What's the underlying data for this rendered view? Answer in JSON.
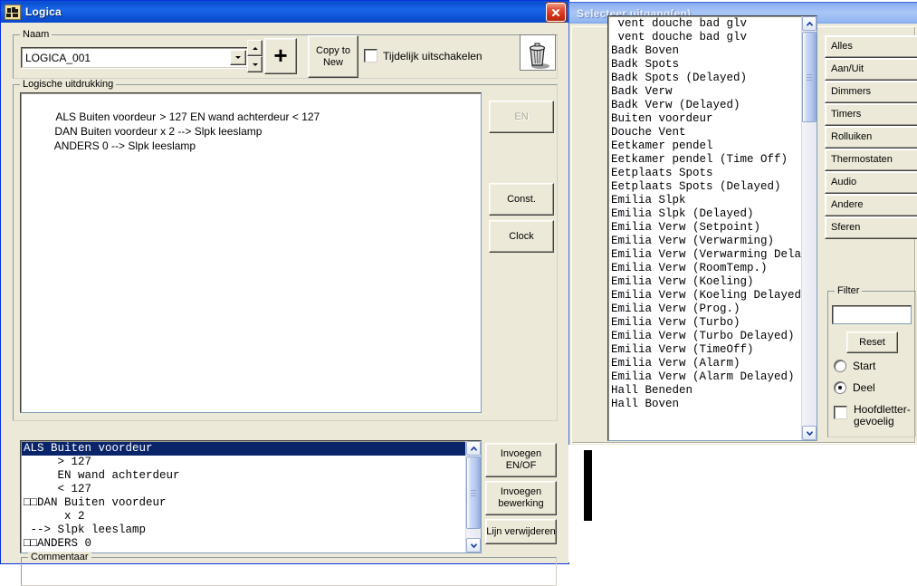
{
  "main_window": {
    "title": "Logica",
    "icon": "logica-app-icon",
    "close_label": "×",
    "naam_group": {
      "label": "Naam",
      "value": "LOGICA_001",
      "placeholder": ""
    },
    "add_button_label": "+",
    "copy_to_new_label": "Copy to\nNew",
    "copy_to_new_line1": "Copy to",
    "copy_to_new_line2": "New",
    "disable_checkbox": {
      "label": "Tijdelijk uitschakelen",
      "checked": false
    },
    "trash_icon": "trash-can-icon",
    "expression_group": {
      "label": "Logische uitdrukking",
      "lines": [
        {
          "selected_text": "ALS Buiten voordeur",
          "rest_text": " > 127 EN wand achterdeur < 127"
        },
        {
          "selected_text": "",
          "rest_text": "DAN Buiten voordeur x 2 --> Slpk leeslamp"
        },
        {
          "selected_text": "",
          "rest_text": "ANDERS 0 --> Slpk leeslamp"
        }
      ]
    },
    "side_buttons": [
      {
        "label": "EN",
        "disabled": true
      },
      {
        "label": "Const.",
        "disabled": false
      },
      {
        "label": "Clock",
        "disabled": false
      }
    ],
    "detail_list": {
      "items": [
        {
          "text": "ALS Buiten voordeur",
          "selected": true
        },
        {
          "text": "     > 127",
          "selected": false
        },
        {
          "text": "     EN wand achterdeur",
          "selected": false
        },
        {
          "text": "     < 127",
          "selected": false
        },
        {
          "text": "□□DAN Buiten voordeur",
          "selected": false
        },
        {
          "text": "      x 2",
          "selected": false
        },
        {
          "text": " --> Slpk leeslamp",
          "selected": false
        },
        {
          "text": "□□ANDERS 0",
          "selected": false
        }
      ]
    },
    "detail_buttons": [
      {
        "line1": "Invoegen",
        "line2": "EN/OF"
      },
      {
        "line1": "Invoegen",
        "line2": "bewerking"
      },
      {
        "line1": "Lijn verwijderen",
        "line2": ""
      }
    ],
    "commentaar_label": "Commentaar"
  },
  "dialog": {
    "title": "Selecteer uitgang(en)",
    "list_items": [
      " vent douche bad glv",
      " vent douche bad glv",
      "Badk Boven",
      "Badk Spots",
      "Badk Spots (Delayed)",
      "Badk Verw",
      "Badk Verw (Delayed)",
      "Buiten voordeur",
      "Douche Vent",
      "Eetkamer pendel",
      "Eetkamer pendel (Time Off)",
      "Eetplaats Spots",
      "Eetplaats Spots (Delayed)",
      "Emilia Slpk",
      "Emilia Slpk (Delayed)",
      "Emilia Verw (Setpoint)",
      "Emilia Verw (Verwarming)",
      "Emilia Verw (Verwarming Delayed)",
      "Emilia Verw (RoomTemp.)",
      "Emilia Verw (Koeling)",
      "Emilia Verw (Koeling Delayed)",
      "Emilia Verw (Prog.)",
      "Emilia Verw (Turbo)",
      "Emilia Verw (Turbo Delayed)",
      "Emilia Verw (TimeOff)",
      "Emilia Verw (Alarm)",
      "Emilia Verw (Alarm Delayed)",
      "Hall Beneden",
      "Hall Boven"
    ],
    "category_buttons": [
      "Alles",
      "Aan/Uit",
      "Dimmers",
      "Timers",
      "Rolluiken",
      "Thermostaten",
      "Audio",
      "Andere",
      "Sferen"
    ],
    "filter": {
      "label": "Filter",
      "value": "",
      "reset_label": "Reset",
      "radios": [
        {
          "label": "Start",
          "selected": false
        },
        {
          "label": "Deel",
          "selected": true
        }
      ],
      "checkbox": {
        "line1": "Hoofdletter-",
        "line2": "gevoelig",
        "checked": false
      }
    }
  }
}
